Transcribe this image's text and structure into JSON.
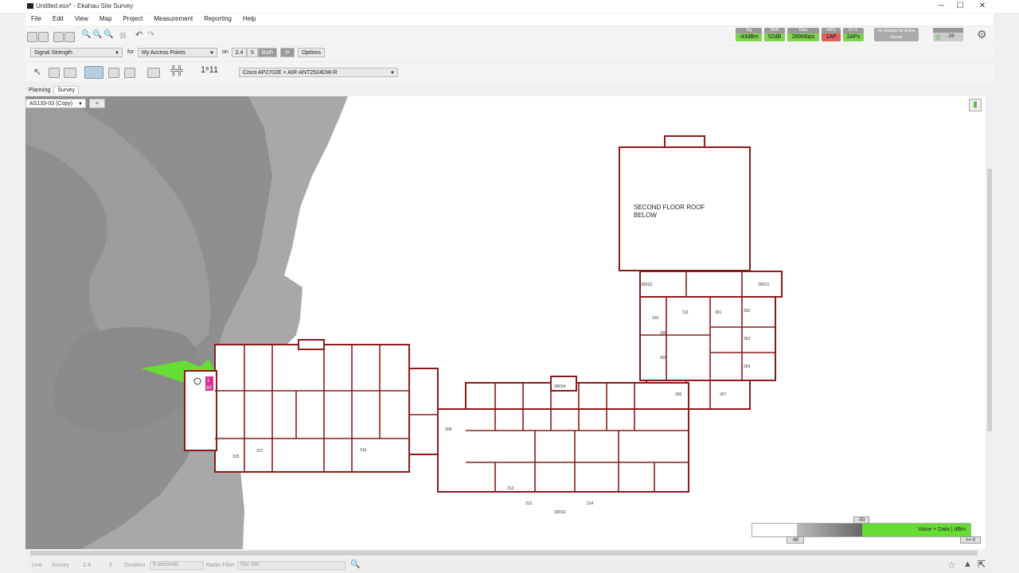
{
  "window": {
    "title": "Untitled.esx* - Ekahau Site Survey",
    "controls": [
      "─",
      "☐",
      "✕"
    ]
  },
  "menu": [
    "File",
    "Edit",
    "View",
    "Map",
    "Project",
    "Measurement",
    "Reporting",
    "Help"
  ],
  "status_badges": [
    {
      "label": "Sig",
      "value": "-43dBm",
      "color": "#7fd34e"
    },
    {
      "label": "SNR",
      "value": "52dB",
      "color": "#7fd34e"
    },
    {
      "label": "Data",
      "value": "289Mbps",
      "color": "#7fd34e"
    },
    {
      "label": "#APs",
      "value": "1AP",
      "color": "#e06060"
    },
    {
      "label": "Ch O.",
      "value": "2APs",
      "color": "#7fd34e"
    }
  ],
  "adapter_status": "No Adapter for Active Survey",
  "signal_readout": "-39",
  "visualization": {
    "selected": "Signal Strength",
    "for_label": "for",
    "access_points": "My Access Points",
    "on_label": "on",
    "bands": [
      "2.4",
      "5",
      "Both"
    ],
    "active_band": "Both",
    "options_label": "Options"
  },
  "ap_model": "Cisco AP2702E + AIR-ANT2524DW-R",
  "tabs": [
    "Planning",
    "Survey"
  ],
  "active_tab": "Survey",
  "floor": {
    "selected": "AS133-03 (Copy)",
    "add_label": "+"
  },
  "map_labels": {
    "roof_line1": "SECOND FLOOR ROOF",
    "roof_line2": "BELOW",
    "rooms": [
      "300S2",
      "300S1",
      "311",
      "301",
      "302",
      "303",
      "304",
      "310",
      "305",
      "309",
      "306",
      "307",
      "308",
      "300S4",
      "300S3",
      "317",
      "316",
      "315",
      "312",
      "313",
      "314"
    ]
  },
  "ap_badge": {
    "index": "1",
    "channel": "60"
  },
  "legend": {
    "low": "-80",
    "high": "-50",
    "label": "Voice + Data",
    "unit": "dBm",
    "ge": ">= 0"
  },
  "statusbar": {
    "live": "Live",
    "survey": "Survey",
    "band_24": "2.4",
    "band_5": "5",
    "duration": "Duration",
    "duration_value": "5 seconds",
    "radio_filter": "Radio Filter",
    "radio_filter_value": "Not Set"
  }
}
